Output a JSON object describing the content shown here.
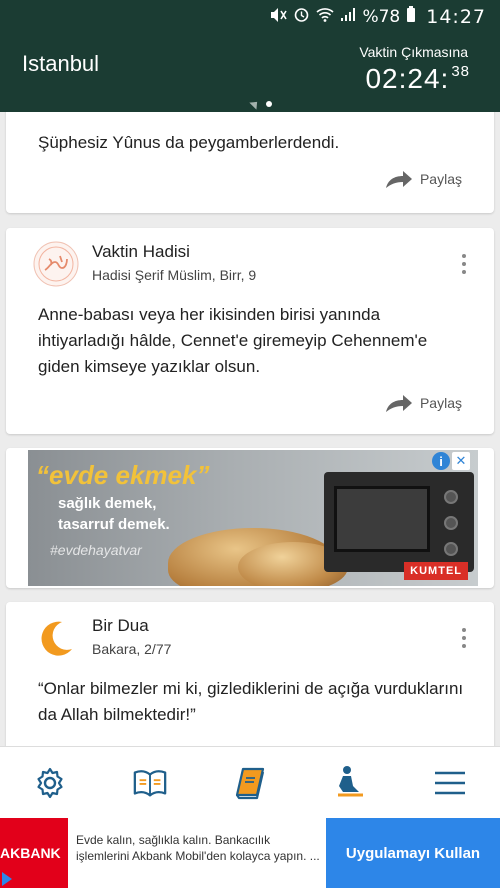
{
  "status_bar": {
    "icons": [
      "mute-icon",
      "alarm-icon",
      "wifi-icon",
      "signal-icon",
      "battery-icon"
    ],
    "battery": "%78",
    "time": "14:27"
  },
  "header": {
    "city": "Istanbul",
    "countdown_label": "Vaktin Çıkmasına",
    "countdown_main": "02:24:",
    "countdown_seconds": "38"
  },
  "cards": {
    "verse": {
      "text": "Şüphesiz Yûnus da peygamberlerdendi.",
      "share_label": "Paylaş"
    },
    "hadith": {
      "title": "Vaktin Hadisi",
      "subtitle": "Hadisi Şerif  Müslim, Birr, 9",
      "text": "Anne-babası veya her ikisinden birisi yanında ihtiyarladığı hâlde, Cennet'e giremeyip Cehennem'e giden kimseye yazıklar olsun.",
      "share_label": "Paylaş"
    },
    "ad": {
      "slogan": "“evde ekmek”",
      "line1": "sağlık demek,",
      "line2": "tasarruf demek.",
      "hashtag": "#evdehayatvar",
      "brand": "KUMTEL"
    },
    "prayer": {
      "title": "Bir Dua",
      "subtitle": "Bakara, 2/77",
      "text": "“Onlar bilmezler mi ki, gizlediklerini de açığa vurduklarını da Allah bilmektedir!”"
    }
  },
  "bottom_nav": [
    "settings-icon",
    "quran-icon",
    "book-icon",
    "prayer-icon",
    "menu-icon"
  ],
  "bottom_ad": {
    "logo": "AKBANK",
    "text": "Evde kalın, sağlıkla kalın. Bankacılık işlemlerini Akbank Mobil'den kolayca yapın. ...",
    "button": "Uygulamayı Kullan"
  },
  "colors": {
    "header_bg": "#1b3c33",
    "accent_orange": "#f29a1f",
    "ad_button": "#2d86e8",
    "akbank_red": "#e2001a"
  }
}
